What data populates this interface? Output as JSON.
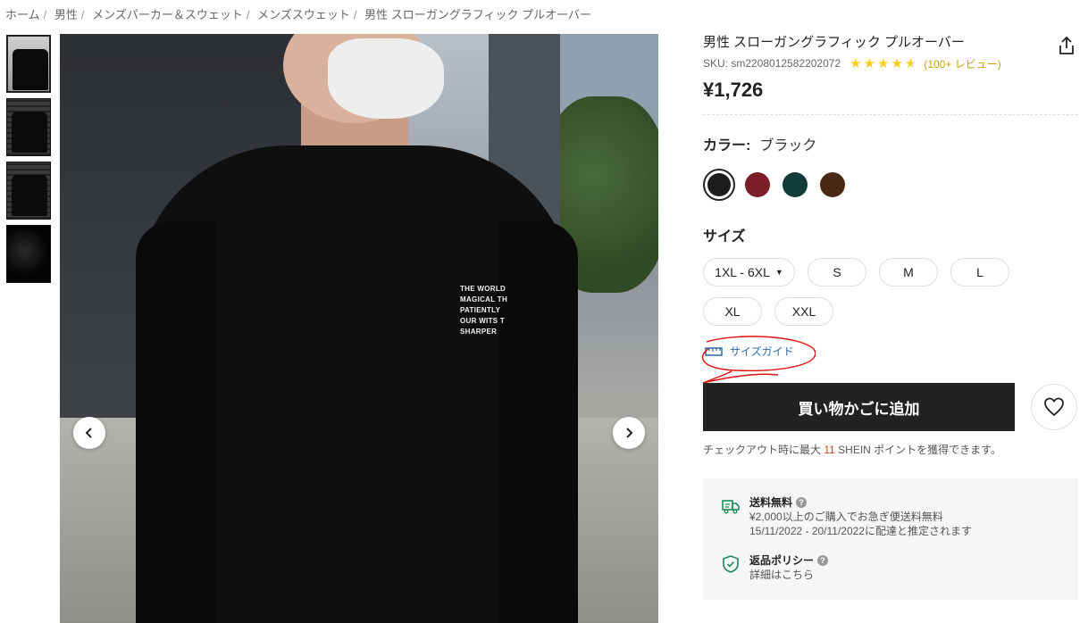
{
  "breadcrumb": [
    "ホーム",
    "男性",
    "メンズパーカー＆スウェット",
    "メンズスウェット",
    "男性 スローガングラフィック プルオーバー"
  ],
  "product": {
    "title": "男性 スローガングラフィック プルオーバー",
    "sku": "SKU: sm2208012582202072",
    "rating_stars": 4.5,
    "reviews": "(100+ レビュー)",
    "price": "¥1,726",
    "print_lines": [
      "THE WORLD",
      "MAGICAL TH",
      "PATIENTLY",
      "OUR WITS T",
      "SHARPER"
    ]
  },
  "color": {
    "label": "カラー:",
    "selected": "ブラック",
    "swatches": [
      {
        "name": "black",
        "hex": "#1c1c1c"
      },
      {
        "name": "burgundy",
        "hex": "#7b1e28"
      },
      {
        "name": "dark-green",
        "hex": "#133c38"
      },
      {
        "name": "brown",
        "hex": "#4a2816"
      }
    ]
  },
  "size": {
    "label": "サイズ",
    "dropdown": "1XL - 6XL",
    "options": [
      "S",
      "M",
      "L",
      "XL",
      "XXL"
    ],
    "guide": "サイズガイド"
  },
  "cta": {
    "add_to_cart": "買い物かごに追加",
    "points_prefix": "チェックアウト時に最大",
    "points_num": "11",
    "points_suffix": "SHEIN ポイントを獲得できます。"
  },
  "shipping": {
    "title": "送料無料",
    "line1": "¥2,000以上のご購入でお急ぎ便送料無料",
    "line2": "15/11/2022 - 20/11/2022に配達と推定されます",
    "qmark": "?"
  },
  "returns": {
    "title": "返品ポリシー",
    "line1": "詳細はこちら",
    "qmark": "?"
  },
  "colors": {
    "accent_star": "#facf19",
    "button_bg": "#222222",
    "link": "#2d68a8",
    "annotation": "#e01010"
  }
}
